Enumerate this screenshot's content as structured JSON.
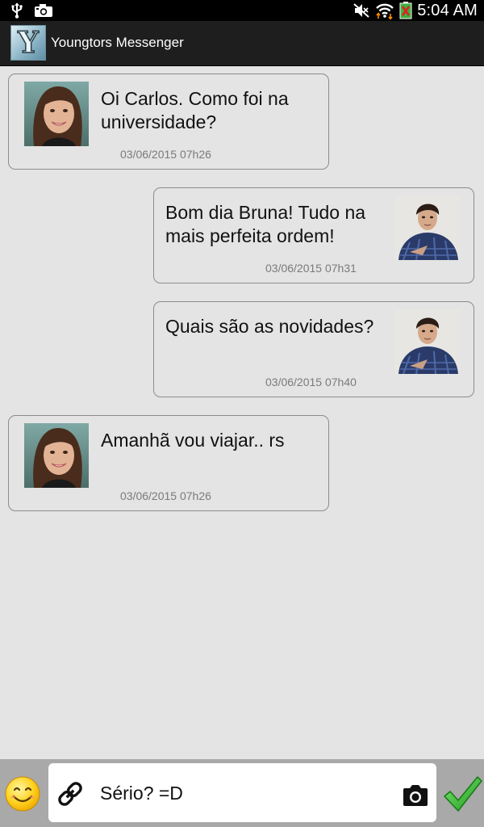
{
  "status_bar": {
    "time": "5:04 AM",
    "icons": [
      "usb-icon",
      "camera-notification-icon",
      "mute-icon",
      "wifi-icon",
      "battery-icon"
    ]
  },
  "app": {
    "logo_letter": "Y",
    "title": "Youngtors Messenger"
  },
  "messages": [
    {
      "direction": "received",
      "text": "Oi Carlos. Como foi na universidade?",
      "time": "03/06/2015 07h26"
    },
    {
      "direction": "sent",
      "text": "Bom dia Bruna! Tudo na mais perfeita ordem!",
      "time": "03/06/2015 07h31"
    },
    {
      "direction": "sent",
      "text": "Quais são as novidades?",
      "time": "03/06/2015 07h40"
    },
    {
      "direction": "received",
      "text": "Amanhã vou viajar.. rs",
      "time": "03/06/2015 07h26"
    }
  ],
  "composer": {
    "input_value": "Sério? =D",
    "icons": [
      "smiley-emoji-icon",
      "link-icon",
      "camera-icon",
      "checkmark-send-icon"
    ]
  },
  "colors": {
    "background": "#e4e4e4",
    "action_bar": "#1e1e1e",
    "composer_bar": "#a9a9a9",
    "send_check": "#2fb52f"
  }
}
